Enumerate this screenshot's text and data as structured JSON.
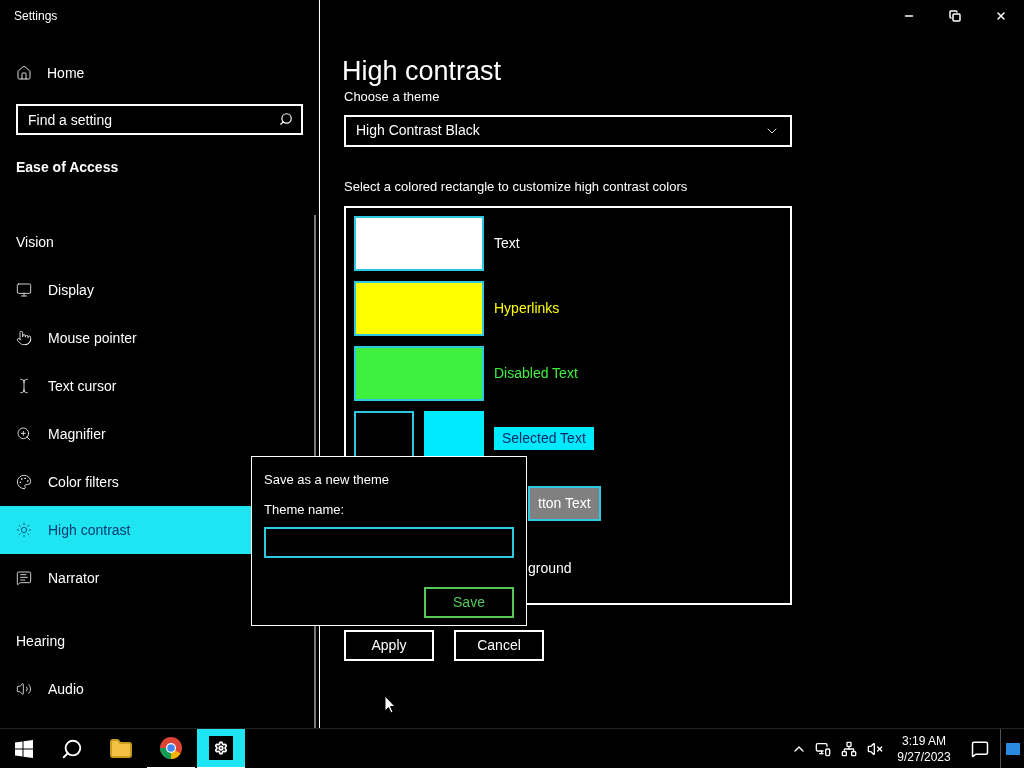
{
  "window": {
    "title": "Settings"
  },
  "sidebar": {
    "home": "Home",
    "search": {
      "placeholder": "Find a setting"
    },
    "category": "Ease of Access",
    "groups": [
      {
        "heading": "Vision",
        "items": [
          {
            "label": "Display",
            "selected": false
          },
          {
            "label": "Mouse pointer",
            "selected": false
          },
          {
            "label": "Text cursor",
            "selected": false
          },
          {
            "label": "Magnifier",
            "selected": false
          },
          {
            "label": "Color filters",
            "selected": false
          },
          {
            "label": "High contrast",
            "selected": true
          },
          {
            "label": "Narrator",
            "selected": false
          }
        ]
      },
      {
        "heading": "Hearing",
        "items": [
          {
            "label": "Audio",
            "selected": false
          }
        ]
      }
    ]
  },
  "main": {
    "title": "High contrast",
    "theme_label": "Choose a theme",
    "theme_value": "High Contrast Black",
    "colors_label": "Select a colored rectangle to customize high contrast colors",
    "color_rows": [
      {
        "kind": "single",
        "swatches": [
          {
            "color": "#ffffff"
          }
        ],
        "label": "Text"
      },
      {
        "kind": "single",
        "swatches": [
          {
            "color": "#ffff00"
          }
        ],
        "label": "Hyperlinks"
      },
      {
        "kind": "single",
        "swatches": [
          {
            "color": "#3ff03f"
          }
        ],
        "label": "Disabled Text"
      },
      {
        "kind": "pair",
        "swatches": [
          {
            "color": "#000000"
          },
          {
            "color": "#00eaff"
          }
        ],
        "label": "Selected Text"
      },
      {
        "kind": "button",
        "label": "tton Text"
      },
      {
        "kind": "background",
        "label": "ground"
      }
    ],
    "buttons": [
      "Apply",
      "Cancel"
    ]
  },
  "dialog": {
    "title": "Save as a new theme",
    "field_label": "Theme name:",
    "button": "Save"
  },
  "taskbar": {
    "apps": [
      {
        "kind": "folder",
        "selected": false,
        "running": false
      },
      {
        "kind": "browser",
        "selected": false,
        "running": true
      },
      {
        "kind": "settings",
        "selected": true,
        "running": true
      }
    ],
    "time": "3:19 AM",
    "date": "9/27/2023"
  }
}
